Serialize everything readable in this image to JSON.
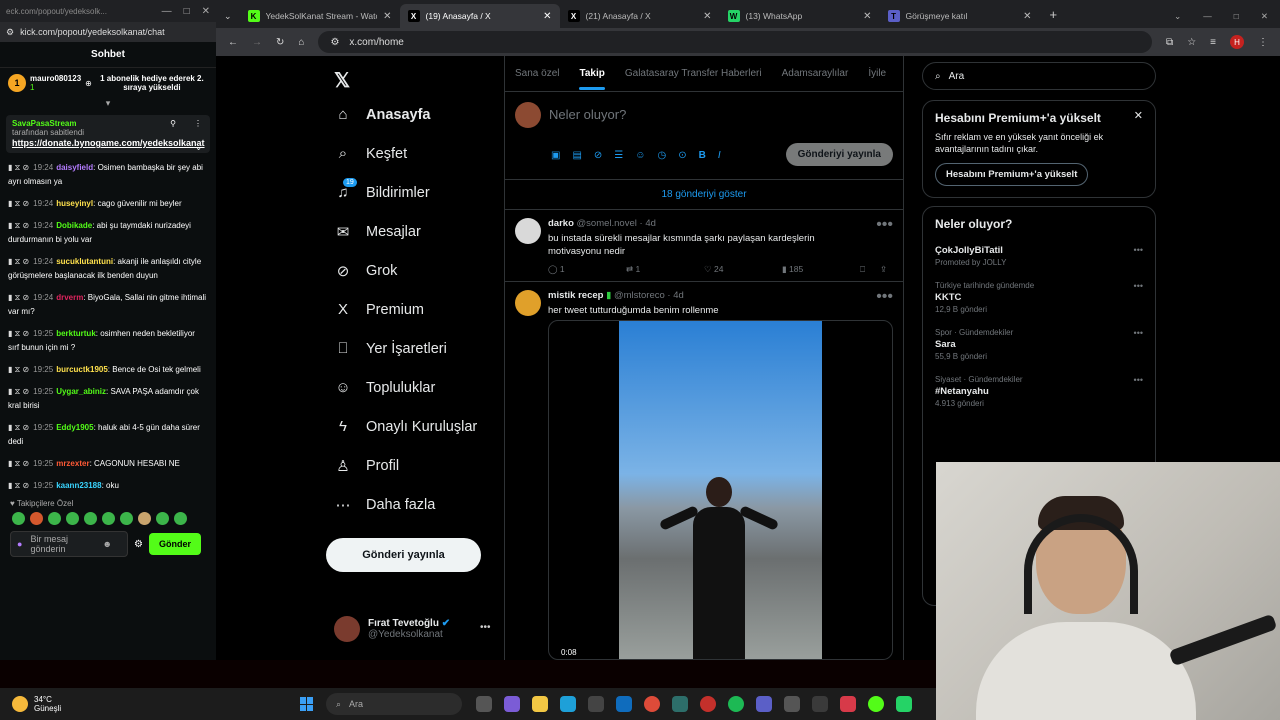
{
  "kick": {
    "url": "kick.com/popout/yedeksolkanat/chat",
    "url_top": "eck.com/popout/yedeksolk...",
    "title": "Sohbet",
    "gift": {
      "user": "mauro080123",
      "count": "1",
      "text": "1 abonelik hediye ederek 2. sıraya yükseldi"
    },
    "pinned": {
      "user": "SavaPasaStream",
      "by": "tarafından sabitlendi",
      "link": "https://donate.bynogame.com/yedeksolkanat"
    },
    "messages": [
      {
        "time": "19:24",
        "user": "daisyfield",
        "color": "#b47cff",
        "text": "Osimen bambaşka bir şey abi ayrı olmasın ya"
      },
      {
        "time": "19:24",
        "user": "huseyinyl",
        "color": "#ffe14d",
        "text": "cago güvenilir mi beyler"
      },
      {
        "time": "19:24",
        "user": "Dobikade",
        "color": "#53fc18",
        "text": "abi şu taymdaki nurizadeyi durdurmanın bi yolu var"
      },
      {
        "time": "19:24",
        "user": "sucuklutantuni",
        "color": "#ffe14d",
        "text": "akanji ile anlaşıldı cityle görüşmelere başlanacak ilk benden duyun"
      },
      {
        "time": "19:24",
        "user": "drverm",
        "color": "#e0245e",
        "text": "BiyoGala, Sallai nin gitme ihtimali var mı?"
      },
      {
        "time": "19:25",
        "user": "berkturtuk",
        "color": "#53fc18",
        "text": "osimhen neden bekletiliyor sırf bunun için mi ?"
      },
      {
        "time": "19:25",
        "user": "burcuctk1905",
        "color": "#ffe14d",
        "text": "Bence de Osi tek gelmeli"
      },
      {
        "time": "19:25",
        "user": "Uygar_abiniz",
        "color": "#53fc18",
        "text": "SAVA PAŞA adamdır çok kral birisi"
      },
      {
        "time": "19:25",
        "user": "Eddy1905",
        "color": "#53fc18",
        "text": "haluk abi 4-5 gün daha sürer dedi"
      },
      {
        "time": "19:25",
        "user": "mrzexter",
        "color": "#ff5a36",
        "text": "CAGONUN HESABI NE"
      },
      {
        "time": "19:25",
        "user": "kaann23188",
        "color": "#3ad5ff",
        "text": "oku"
      }
    ],
    "followers_only": "Takipçilere Özel",
    "input_placeholder": "Bir mesaj gönderin",
    "send_label": "Gönder"
  },
  "browser": {
    "tabs": [
      {
        "label": "YedekSolKanat Stream - Watch",
        "icon": "K",
        "color": "#53fc18"
      },
      {
        "label": "(19) Anasayfa / X",
        "icon": "X",
        "color": "#ffffff"
      },
      {
        "label": "(21) Anasayfa / X",
        "icon": "X",
        "color": "#ffffff"
      },
      {
        "label": "(13) WhatsApp",
        "icon": "W",
        "color": "#25d366"
      },
      {
        "label": "Görüşmeye katıl",
        "icon": "T",
        "color": "#5b5fc7"
      }
    ],
    "url": "x.com/home",
    "profile_letter": "H"
  },
  "x": {
    "nav": [
      {
        "label": "Anasayfa",
        "icon": "home-icon",
        "glyph": "⌂"
      },
      {
        "label": "Keşfet",
        "icon": "search-icon",
        "glyph": "⌕"
      },
      {
        "label": "Bildirimler",
        "icon": "bell-icon",
        "glyph": "♫",
        "badge": "19"
      },
      {
        "label": "Mesajlar",
        "icon": "mail-icon",
        "glyph": "✉"
      },
      {
        "label": "Grok",
        "icon": "grok-icon",
        "glyph": "⊘"
      },
      {
        "label": "Premium",
        "icon": "x-premium-icon",
        "glyph": "X"
      },
      {
        "label": "Yer İşaretleri",
        "icon": "bookmark-icon",
        "glyph": "⎕"
      },
      {
        "label": "Topluluklar",
        "icon": "communities-icon",
        "glyph": "☺"
      },
      {
        "label": "Onaylı Kuruluşlar",
        "icon": "lightning-icon",
        "glyph": "ϟ"
      },
      {
        "label": "Profil",
        "icon": "person-icon",
        "glyph": "♙"
      },
      {
        "label": "Daha fazla",
        "icon": "more-icon",
        "glyph": "⋯"
      }
    ],
    "post_button": "Gönderi yayınla",
    "account": {
      "name": "Fırat Tevetoğlu",
      "handle": "@Yedeksolkanat"
    },
    "feed_tabs": [
      "Sana özel",
      "Takip",
      "Galatasaray Transfer Haberleri",
      "Adamsaraylılar",
      "İyile"
    ],
    "compose_placeholder": "Neler oluyor?",
    "compose_post": "Gönderiyi yayınla",
    "show_more": "18 gönderiyi göster",
    "tweets": [
      {
        "name": "darko",
        "handle": "@somel.novel",
        "age": "4d",
        "text": "bu instada sürekli mesajlar kısmında şarkı paylaşan kardeşlerin motivasyonu nedir",
        "replies": "1",
        "retweets": "1",
        "likes": "24",
        "views": "185"
      },
      {
        "name": "mistik recep",
        "handle": "@mlstoreco",
        "age": "4d",
        "text": "her tweet tutturduğumda benim rollenme",
        "video_time": "0:08"
      }
    ],
    "search_placeholder": "Ara",
    "premium": {
      "title": "Hesabını Premium+'a yükselt",
      "text": "Sıfır reklam ve en yüksek yanıt önceliği ek avantajlarının tadını çıkar.",
      "button": "Hesabını Premium+'a yükselt"
    },
    "trends_title": "Neler oluyor?",
    "trends": [
      {
        "context": "",
        "name": "ÇokJollyBiTatil",
        "count": "Promoted by JOLLY"
      },
      {
        "context": "Türkiye tarihinde gündemde",
        "name": "KKTC",
        "count": "12,9 B gönderi"
      },
      {
        "context": "Spor · Gündemdekiler",
        "name": "Sara",
        "count": "55,9 B gönderi"
      },
      {
        "context": "Siyaset · Gündemdekiler",
        "name": "#Netanyahu",
        "count": "4.913 gönderi"
      }
    ]
  },
  "taskbar": {
    "temp": "34°C",
    "weather": "Güneşli",
    "search": "Ara"
  }
}
